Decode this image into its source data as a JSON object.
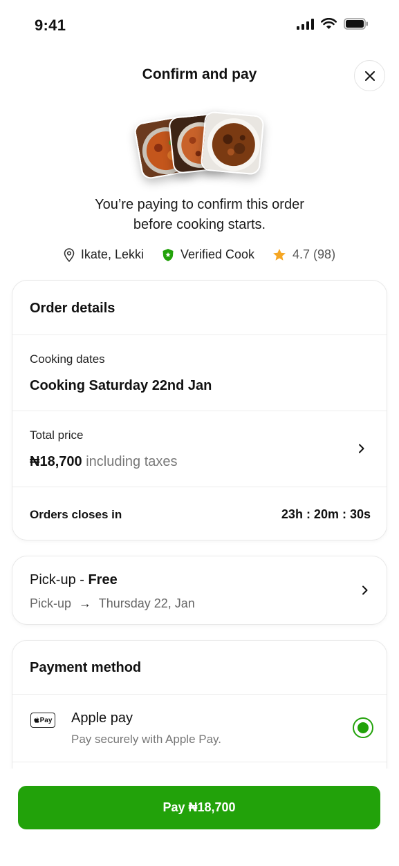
{
  "status": {
    "time": "9:41"
  },
  "header": {
    "title": "Confirm and pay"
  },
  "intro": {
    "line1": "You’re paying to confirm this order",
    "line2": "before cooking starts."
  },
  "meta": {
    "location": "Ikate, Lekki",
    "verified": "Verified Cook",
    "rating": "4.7 (98)"
  },
  "order": {
    "heading": "Order details",
    "cooking_label": "Cooking dates",
    "cooking_value": "Cooking Saturday 22nd Jan",
    "price_label": "Total price",
    "price_value": "₦18,700",
    "price_note": "including taxes",
    "closes_label": "Orders closes in",
    "closes_value": "23h : 20m : 30s"
  },
  "pickup": {
    "title_prefix": "Pick-up - ",
    "title_bold": "Free",
    "from": "Pick-up",
    "arrow": "→",
    "date": "Thursday 22, Jan"
  },
  "payment": {
    "heading": "Payment method",
    "method_badge": "Pay",
    "method_name": "Apple pay",
    "method_desc": "Pay securely with Apple Pay."
  },
  "pay_button": {
    "label": "Pay ₦18,700"
  },
  "colors": {
    "accent": "#22a20a",
    "star": "#f5a623"
  }
}
